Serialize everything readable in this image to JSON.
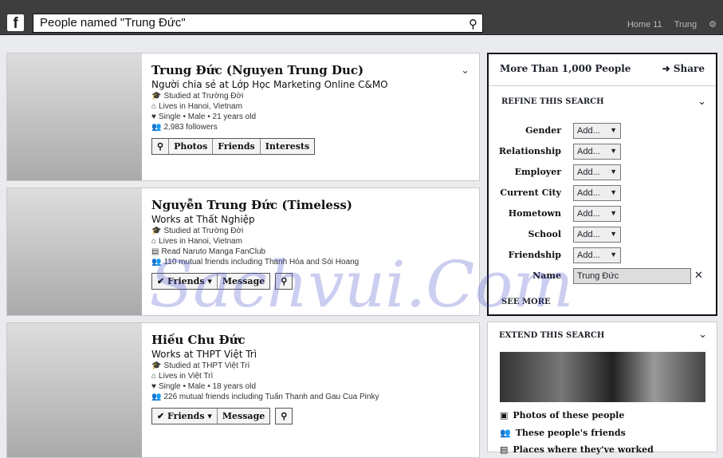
{
  "topbar": {
    "search_query": "People named \"Trung Đức\"",
    "nav": [
      "Home 11",
      "Trung",
      "⚙"
    ]
  },
  "results": [
    {
      "name": "Trung Đức (Nguyen Trung Duc)",
      "subtitle": "Người chia sẻ at Lớp Học Marketing Online C&MO",
      "lines": [
        "Studied at Trường Đời",
        "Lives in Hanoi, Vietnam",
        "Single • Male • 21 years old",
        "2,983 followers"
      ],
      "buttons": [
        "Photos",
        "Friends",
        "Interests"
      ]
    },
    {
      "name": "Nguyễn Trung Đức (Timeless)",
      "subtitle": "Works at Thất Nghiệp",
      "lines": [
        "Studied at Trường Đời",
        "Lives in Hanoi, Vietnam",
        "Read Naruto Manga FanClub",
        "110 mutual friends including Thanh Hóa and Sói Hoang"
      ],
      "buttons": [
        "✔ Friends ▾",
        "Message"
      ]
    },
    {
      "name": "Hiếu Chu Đức",
      "subtitle": "Works at THPT Việt Trì",
      "lines": [
        "Studied at THPT Việt Trì",
        "Lives in Việt Trì",
        "Single • Male • 18 years old",
        "226 mutual friends including Tuấn Thanh and Gau Cua Pinky"
      ],
      "buttons": [
        "✔ Friends ▾",
        "Message"
      ]
    }
  ],
  "sidebar": {
    "title": "More Than 1,000 People",
    "share": "Share",
    "refine": "REFINE THIS SEARCH",
    "filters": [
      {
        "label": "Gender",
        "value": "Add..."
      },
      {
        "label": "Relationship",
        "value": "Add..."
      },
      {
        "label": "Employer",
        "value": "Add..."
      },
      {
        "label": "Current City",
        "value": "Add..."
      },
      {
        "label": "Hometown",
        "value": "Add..."
      },
      {
        "label": "School",
        "value": "Add..."
      },
      {
        "label": "Friendship",
        "value": "Add..."
      }
    ],
    "name_label": "Name",
    "name_value": "Trung Đức",
    "see_more": "SEE MORE",
    "extend": "EXTEND THIS SEARCH",
    "extend_links": [
      "Photos of these people",
      "These people's friends",
      "Places where they've worked"
    ]
  },
  "watermark": "Sachvui.Com"
}
